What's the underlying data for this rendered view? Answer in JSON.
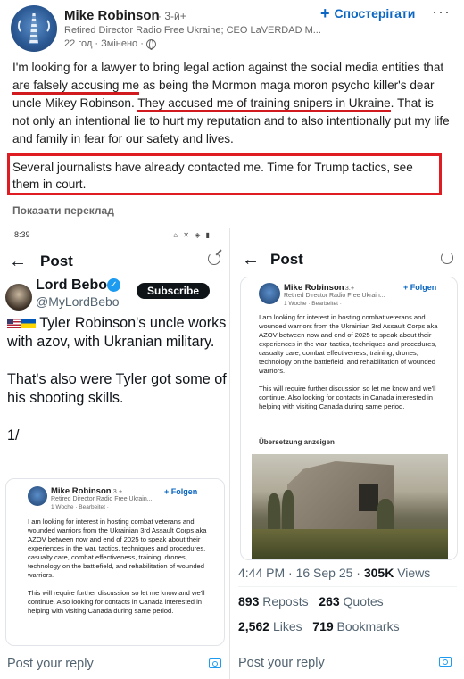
{
  "linkedin_post": {
    "author": "Mike Robinson",
    "degree": "· 3-й+",
    "headline": "Retired Director Radio Free Ukraine; CEO LaVERDAD M...",
    "meta": "22 год · Змінено ·",
    "follow_label": "Спостерігати",
    "more_label": "···",
    "body_part1": "I'm looking for a lawyer to bring legal action against the social media entities that ",
    "body_ul1": "are falsely accusing me",
    "body_part2": " as being the Mormon maga moron psycho killer's dear uncle Mikey Robinson. ",
    "body_ul2": "They accused me of training snipers in Ukraine",
    "body_part3": ". That is not only an intentional lie to hurt my reputation and to also intentionally put my life and family in fear for our safety and lives.",
    "body_boxed": "Several journalists have already contacted me. Time for Trump tactics, see them in court.",
    "translate_label": "Показати переклад"
  },
  "left_phone": {
    "status_time": "8:39",
    "status_icons": "⌂ ✕ ◈ ▮",
    "header_title": "Post",
    "back_icon": "←",
    "author_name": "Lord Bebo",
    "handle": "@MyLordBebo",
    "subscribe_label": "Subscribe",
    "tweet_line1": "Tyler Robinson's uncle works with azov, with Ukranian military.",
    "tweet_line2": "That's also were Tyler got some of his shooting skills.",
    "tweet_line3": "1/",
    "embed": {
      "name": "Mike Robinson",
      "degree": "· 3.+",
      "follow": "+ Folgen",
      "headline": "Retired Director Radio Free Ukrain...",
      "meta": "1 Woche · Bearbeitet ·",
      "para1": "I am looking for interest in hosting combat veterans and wounded warriors from the  Ukrainian 3rd Assault Corps aka AZOV between now and end of 2025 to speak about their experiences in the war, tactics, techniques and procedures, casualty care, combat effectiveness, training, drones, technology on the battlefield, and rehabilitation of wounded warriors.",
      "para2": "This will require further discussion so let me know and we'll continue. Also looking for contacts in Canada interested in helping with visiting Canada during same period."
    },
    "reply_placeholder": "Post your reply"
  },
  "right_phone": {
    "header_title": "Post",
    "back_icon": "←",
    "embed": {
      "name": "Mike Robinson",
      "degree": "· 3.+",
      "follow": "+ Folgen",
      "headline": "Retired Director Radio Free Ukrain...",
      "meta": "1 Woche · Bearbeitet ·",
      "para1": "I am looking for interest in hosting combat veterans and wounded warriors from the  Ukrainian 3rd Assault Corps aka AZOV between now and end of 2025 to speak about their experiences in the war, tactics, techniques and procedures, casualty care, combat effectiveness, training, drones, technology on the battlefield, and rehabilitation of wounded warriors.",
      "para2": "This will require further discussion so let me know and we'll continue. Also looking for contacts in Canada interested in helping with visiting Canada during same period.",
      "translate": "Übersetzung anzeigen"
    },
    "timestamp": "4:44 PM · 16 Sep 25 ·",
    "views_count": "305K",
    "views_label": "Views",
    "reposts_count": "893",
    "reposts_label": "Reposts",
    "quotes_count": "263",
    "quotes_label": "Quotes",
    "likes_count": "2,562",
    "likes_label": "Likes",
    "bookmarks_count": "719",
    "bookmarks_label": "Bookmarks",
    "reply_placeholder": "Post your reply"
  },
  "colors": {
    "linkedin_blue": "#0a66c2",
    "highlight_red": "#e01c23",
    "x_blue": "#1d9bf0"
  }
}
